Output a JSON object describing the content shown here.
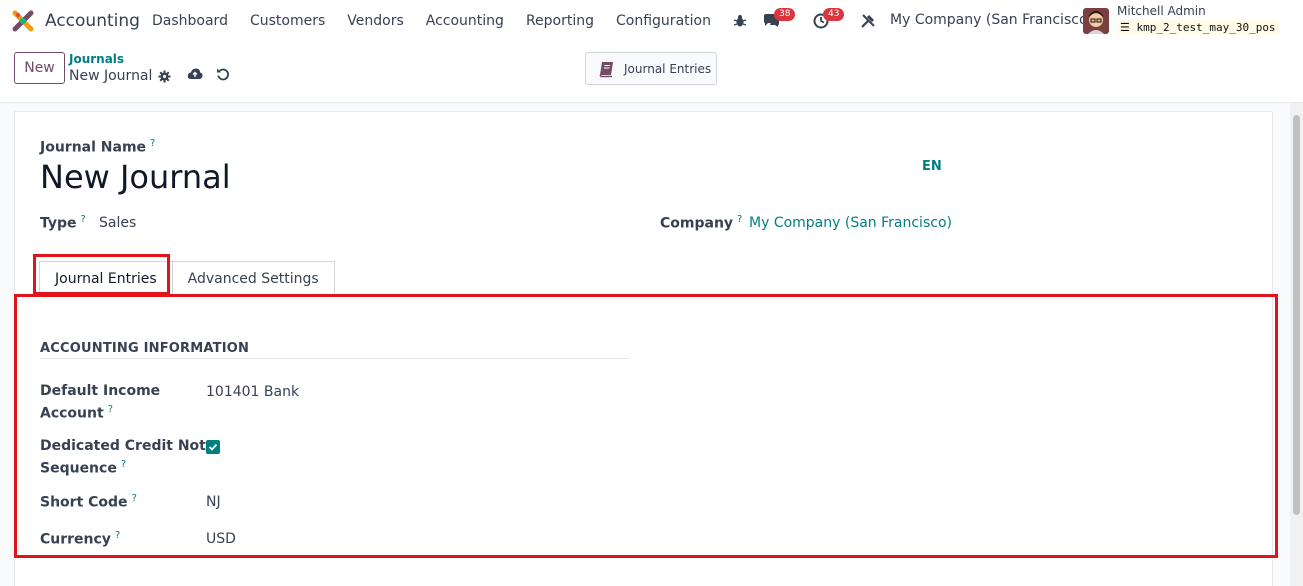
{
  "navbar": {
    "app_name": "Accounting",
    "menu": [
      "Dashboard",
      "Customers",
      "Vendors",
      "Accounting",
      "Reporting",
      "Configuration"
    ],
    "messages_count": "38",
    "activities_count": "43",
    "company": "My Company (San Francisco)",
    "user_name": "Mitchell Admin",
    "database": "kmp_2_test_may_30_pos"
  },
  "control": {
    "new_label": "New",
    "breadcrumb_parent": "Journals",
    "breadcrumb_current": "New Journal",
    "smart_button_label": "Journal Entries"
  },
  "form": {
    "journal_name_label": "Journal Name",
    "journal_name": "New Journal",
    "lang": "EN",
    "type_label": "Type",
    "type_value": "Sales",
    "company_label": "Company",
    "company_value": "My Company (San Francisco)",
    "help_mark": "?",
    "tabs": [
      "Journal Entries",
      "Advanced Settings"
    ],
    "section_title": "ACCOUNTING INFORMATION",
    "fields": {
      "income_account_label_1": "Default Income",
      "income_account_label_2": "Account",
      "income_account_value": "101401 Bank",
      "credit_note_label_1": "Dedicated Credit Note",
      "credit_note_label_2": "Sequence",
      "credit_note_checked": true,
      "short_code_label": "Short Code",
      "short_code_value": "NJ",
      "currency_label": "Currency",
      "currency_value": "USD"
    }
  },
  "colors": {
    "brand": "#714b67",
    "link": "#017e84",
    "badge": "#d9363e",
    "highlight": "#e3131b"
  }
}
